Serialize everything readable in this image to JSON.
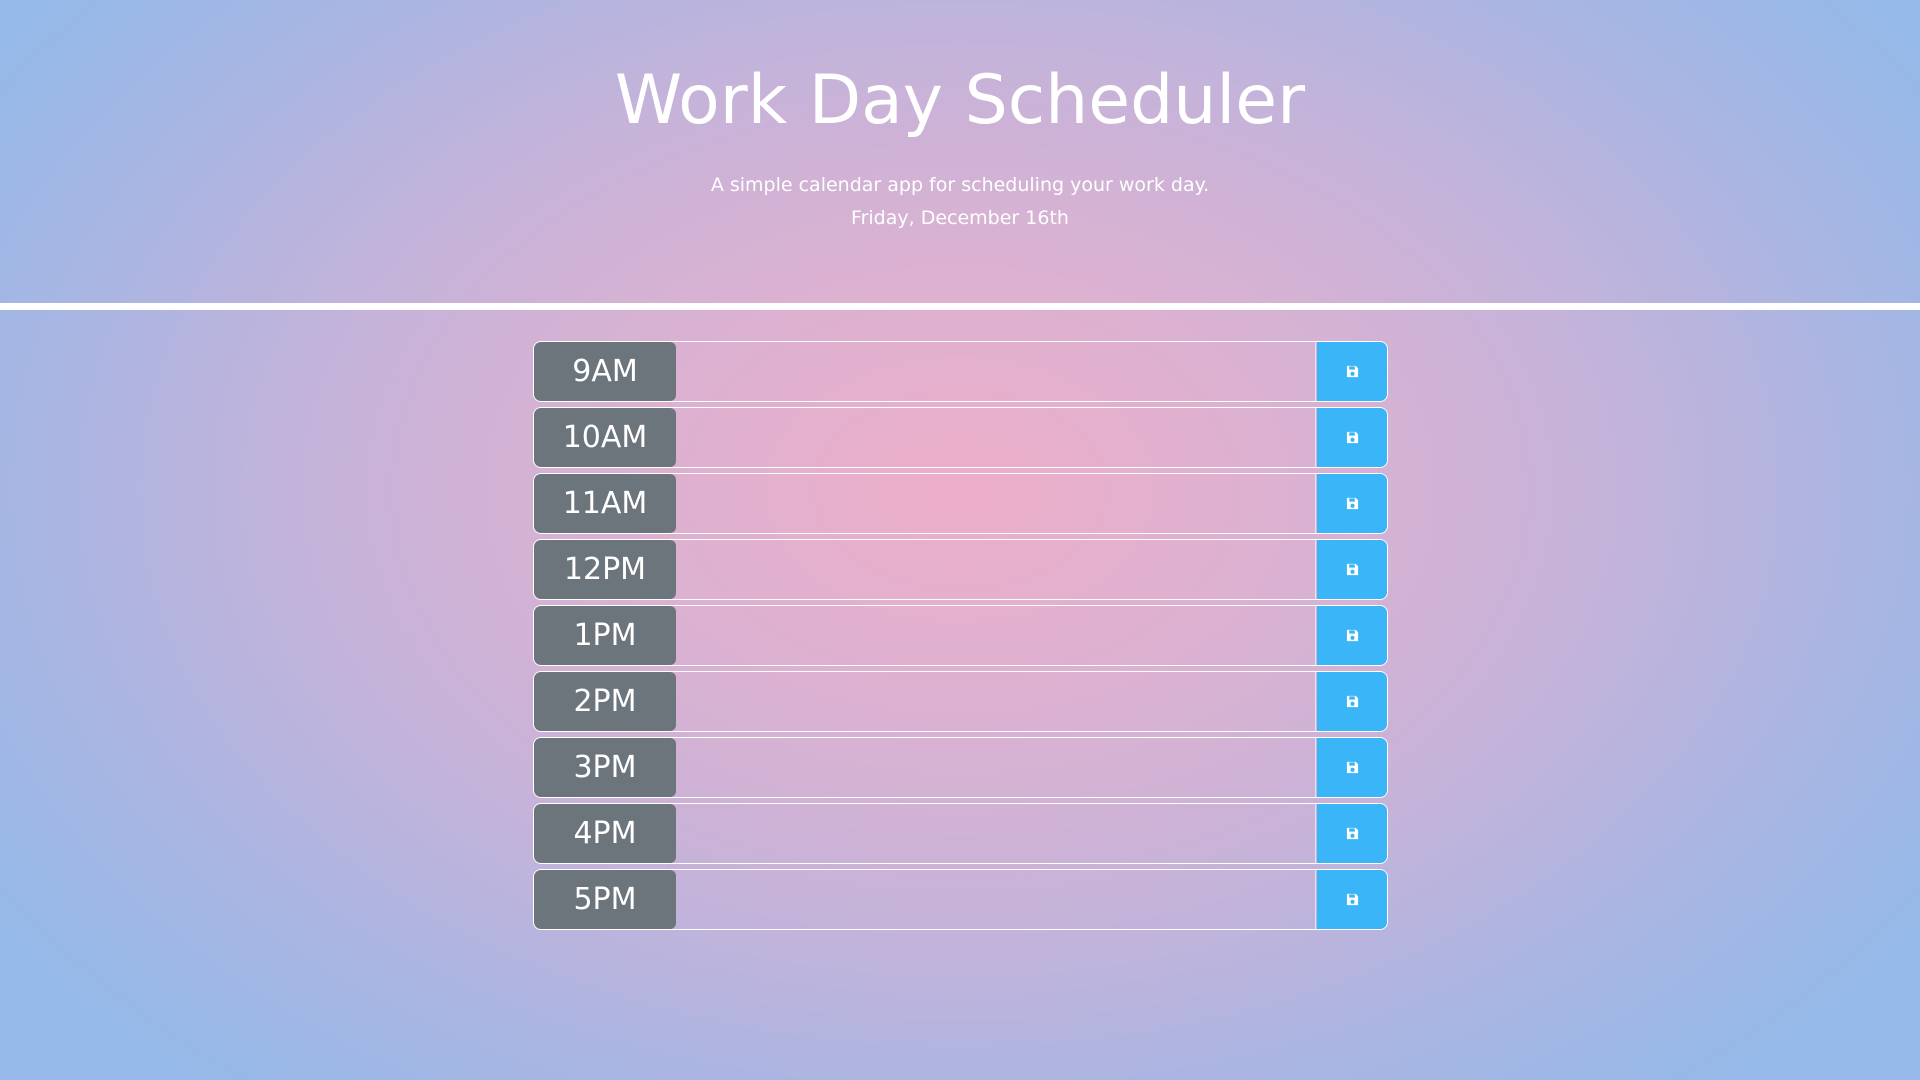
{
  "header": {
    "title": "Work Day Scheduler",
    "subtitle": "A simple calendar app for scheduling your work day.",
    "current_day": "Friday, December 16th"
  },
  "colors": {
    "hour_label_bg": "#6c747c",
    "save_button_bg": "#3ab5f7",
    "divider": "#ffffff",
    "text": "#ffffff"
  },
  "time_blocks": [
    {
      "hour": "9AM",
      "description": "",
      "save_icon": "save-icon"
    },
    {
      "hour": "10AM",
      "description": "",
      "save_icon": "save-icon"
    },
    {
      "hour": "11AM",
      "description": "",
      "save_icon": "save-icon"
    },
    {
      "hour": "12PM",
      "description": "",
      "save_icon": "save-icon"
    },
    {
      "hour": "1PM",
      "description": "",
      "save_icon": "save-icon"
    },
    {
      "hour": "2PM",
      "description": "",
      "save_icon": "save-icon"
    },
    {
      "hour": "3PM",
      "description": "",
      "save_icon": "save-icon"
    },
    {
      "hour": "4PM",
      "description": "",
      "save_icon": "save-icon"
    },
    {
      "hour": "5PM",
      "description": "",
      "save_icon": "save-icon"
    }
  ]
}
